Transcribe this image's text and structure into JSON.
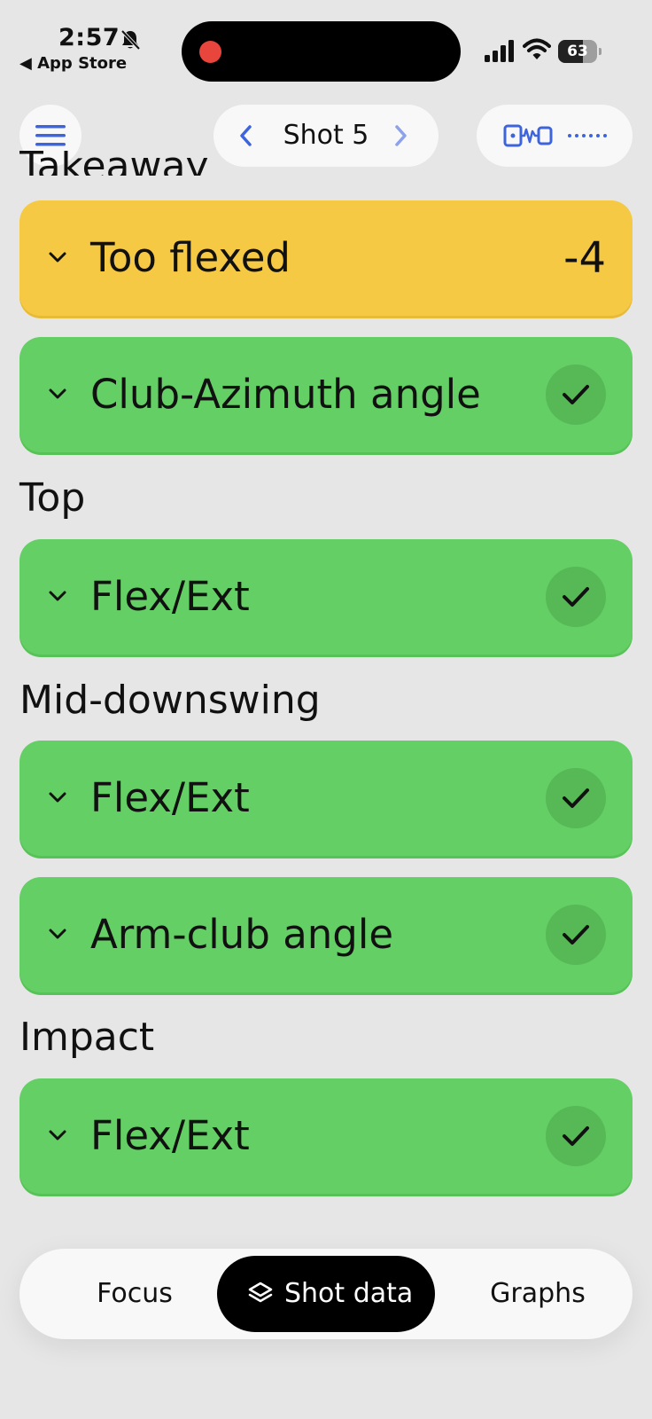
{
  "status_bar": {
    "time": "2:57",
    "back_app": "App Store",
    "battery": "63",
    "battery_level": 0.63
  },
  "header": {
    "shot_label": "Shot 5"
  },
  "sections": {
    "takeaway": {
      "title": "Takeaway",
      "items": [
        {
          "label": "Too flexed",
          "score": "-4",
          "status": "warning",
          "color": "#f6c944"
        },
        {
          "label": "Club-Azimuth angle",
          "status": "ok",
          "color": "#64cf64"
        }
      ]
    },
    "top": {
      "title": "Top",
      "items": [
        {
          "label": "Flex/Ext",
          "status": "ok"
        }
      ]
    },
    "mid_downswing": {
      "title": "Mid-downswing",
      "items": [
        {
          "label": "Flex/Ext",
          "status": "ok"
        },
        {
          "label": "Arm-club angle",
          "status": "ok"
        }
      ]
    },
    "impact": {
      "title": "Impact",
      "items": [
        {
          "label": "Flex/Ext",
          "status": "ok"
        }
      ]
    }
  },
  "tabbar": {
    "focus": "Focus",
    "shot_data": "Shot data",
    "graphs": "Graphs",
    "active": "shot_data"
  },
  "colors": {
    "accent_blue": "#3d63dd",
    "ok_green": "#64cf64",
    "warning_yellow": "#f6c944"
  }
}
